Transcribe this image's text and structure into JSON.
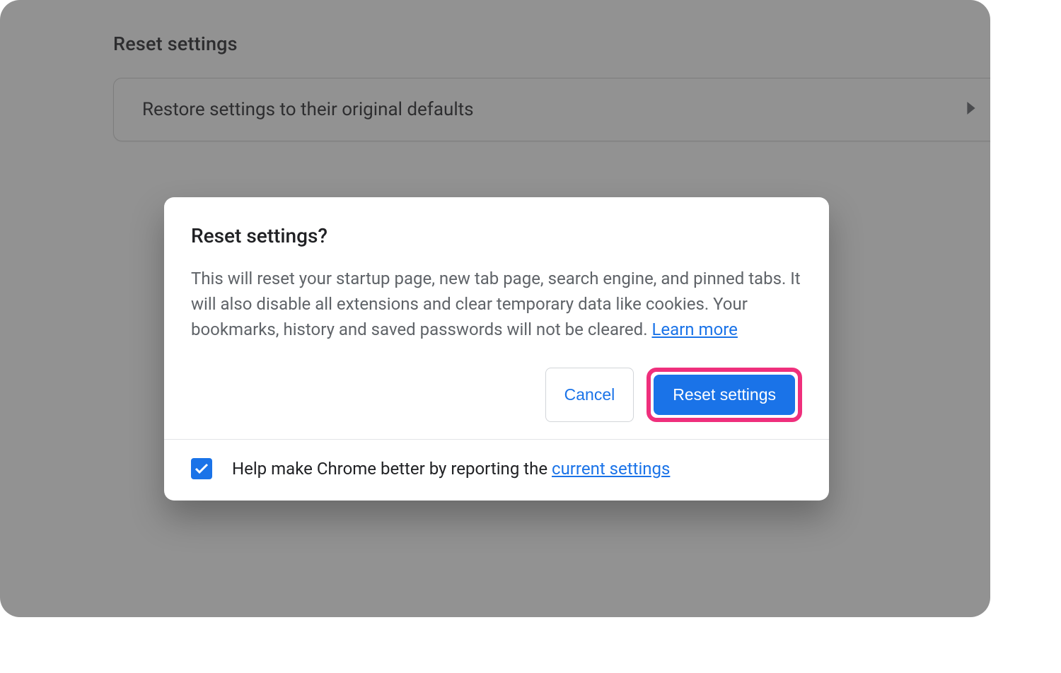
{
  "page": {
    "title": "Reset settings",
    "row_label": "Restore settings to their original defaults"
  },
  "dialog": {
    "title": "Reset settings?",
    "body_text": "This will reset your startup page, new tab page, search engine, and pinned tabs. It will also disable all extensions and clear temporary data like cookies. Your bookmarks, history and saved passwords will not be cleared. ",
    "learn_more": "Learn more",
    "cancel_label": "Cancel",
    "confirm_label": "Reset settings",
    "footer_prefix": "Help make Chrome better by reporting the ",
    "footer_link": "current settings",
    "report_checked": true
  },
  "colors": {
    "accent": "#1a73e8",
    "highlight": "#ef2f7c"
  }
}
